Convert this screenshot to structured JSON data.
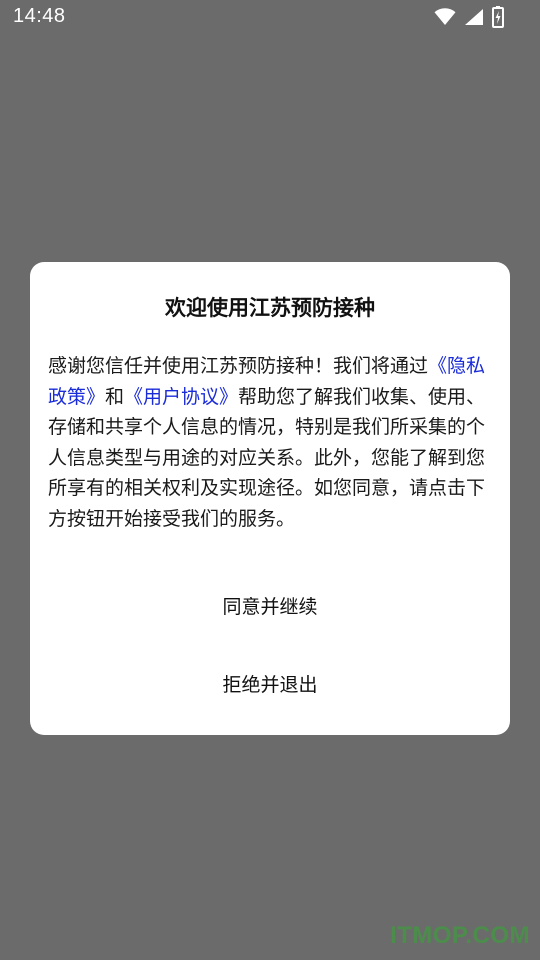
{
  "status_bar": {
    "time": "14:48",
    "icons": [
      "wifi-icon",
      "signal-icon",
      "battery-charging-icon"
    ]
  },
  "dialog": {
    "title": "欢迎使用江苏预防接种",
    "body": {
      "intro": "感谢您信任并使用江苏预防接种！我们将通过",
      "privacy_link": "《隐私政策》",
      "conjunction": "和",
      "user_agreement_link": "《用户协议》",
      "rest": "帮助您了解我们收集、使用、存储和共享个人信息的情况，特别是我们所采集的个人信息类型与用途的对应关系。此外，您能了解到您所享有的相关权利及实现途径。如您同意，请点击下方按钮开始接受我们的服务。"
    },
    "agree_button": "同意并继续",
    "decline_button": "拒绝并退出"
  },
  "watermark": "ITMOP.COM",
  "colors": {
    "backdrop": "#6b6b6b",
    "dialog_bg": "#ffffff",
    "link": "#1a2bd8",
    "watermark": "#33aa33"
  }
}
